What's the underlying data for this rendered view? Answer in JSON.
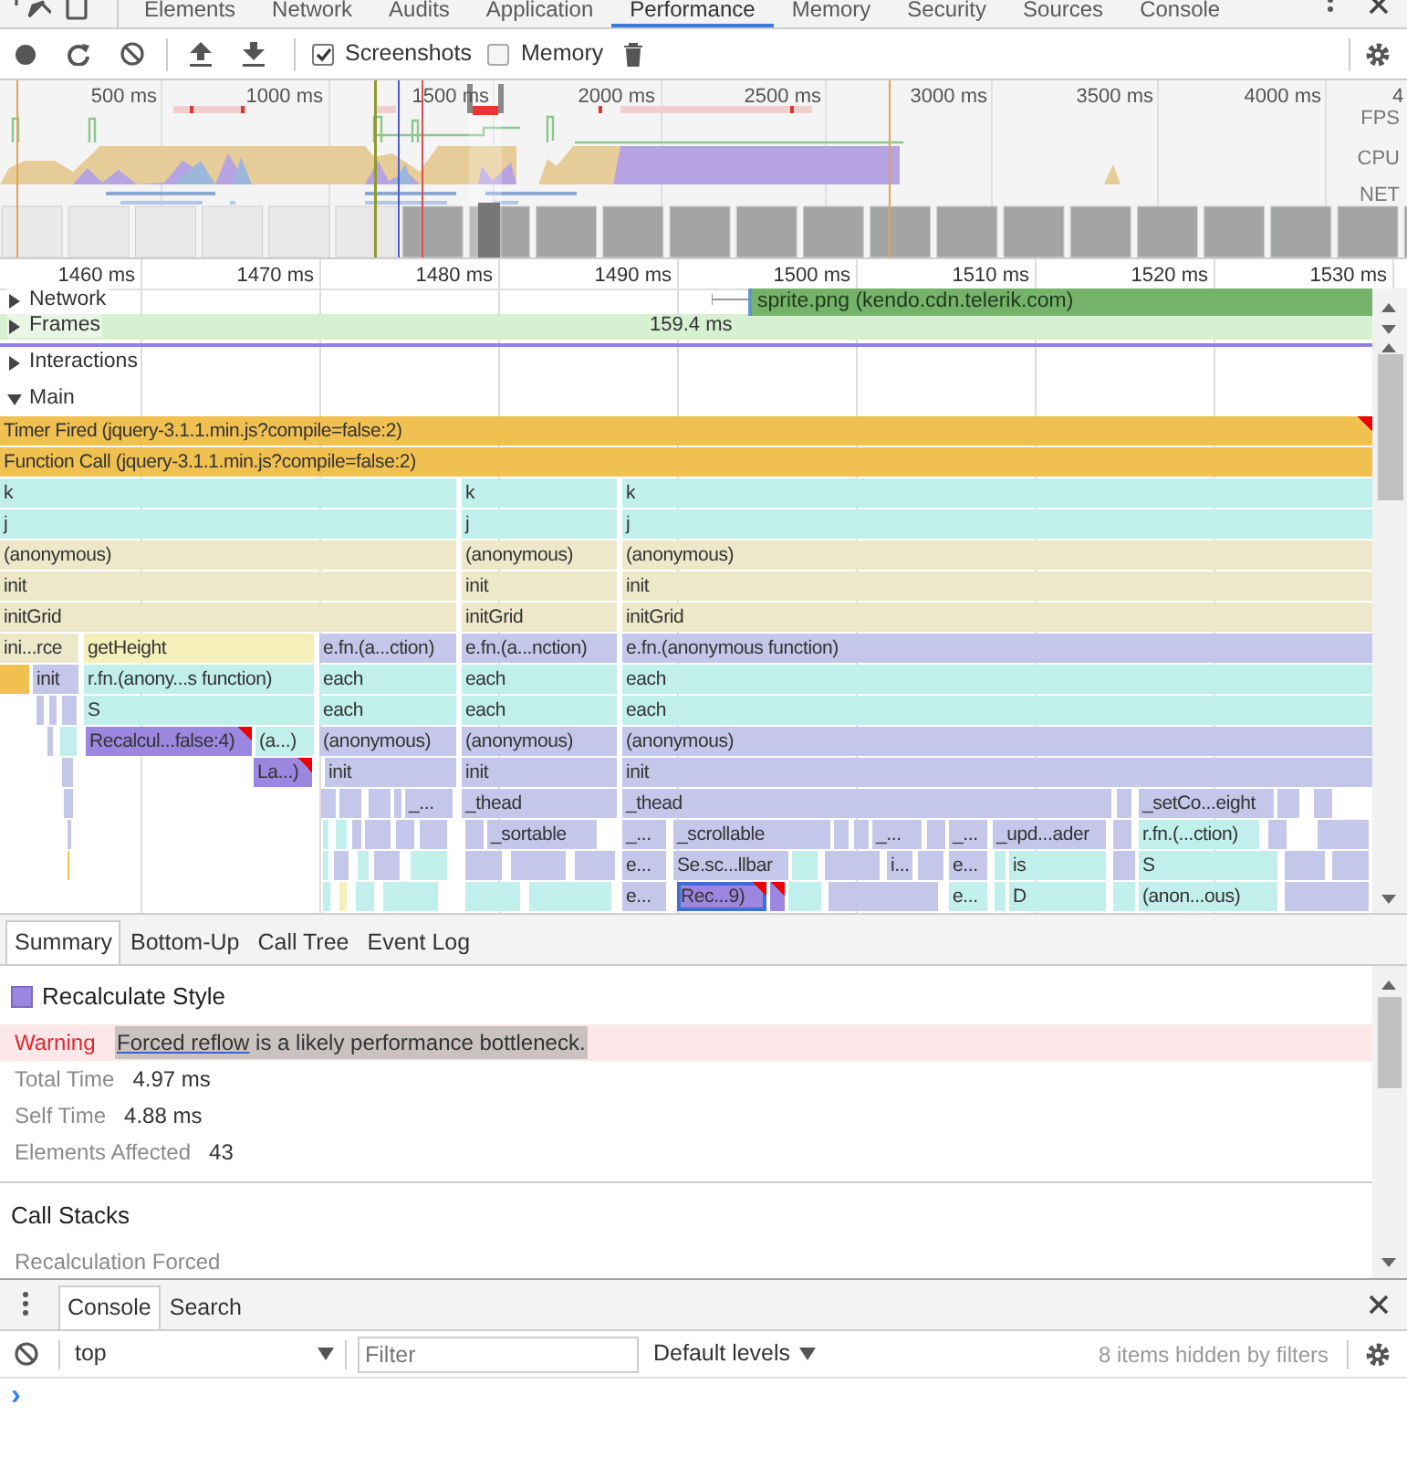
{
  "top_tabs": [
    {
      "label": "Elements",
      "selected": false
    },
    {
      "label": "Network",
      "selected": false
    },
    {
      "label": "Audits",
      "selected": false
    },
    {
      "label": "Application",
      "selected": false
    },
    {
      "label": "Performance",
      "selected": true
    },
    {
      "label": "Memory",
      "selected": false
    },
    {
      "label": "Security",
      "selected": false
    },
    {
      "label": "Sources",
      "selected": false
    },
    {
      "label": "Console",
      "selected": false
    }
  ],
  "toolbar": {
    "options": [
      {
        "label": "Screenshots",
        "checked": true
      },
      {
        "label": "Memory",
        "checked": false
      }
    ]
  },
  "overview": {
    "ticks": [
      "500 ms",
      "1000 ms",
      "1500 ms",
      "2000 ms",
      "2500 ms",
      "3000 ms",
      "3500 ms",
      "4000 ms",
      "4"
    ],
    "lanes": [
      "FPS",
      "CPU",
      "NET"
    ]
  },
  "ruler": [
    "1460 ms",
    "1470 ms",
    "1480 ms",
    "1490 ms",
    "1500 ms",
    "1510 ms",
    "1520 ms",
    "1530 ms"
  ],
  "tracks": [
    {
      "label": "Network",
      "expanded": false
    },
    {
      "label": "Frames",
      "expanded": false
    },
    {
      "label": "Interactions",
      "expanded": false
    },
    {
      "label": "Main",
      "expanded": true
    }
  ],
  "network_request": "sprite.png (kendo.cdn.telerik.com)",
  "frame_duration": "159.4 ms",
  "flame_rows": [
    [
      {
        "label": "Timer Fired (jquery-3.1.1.min.js?compile=false:2)",
        "color": "#f0c050",
        "warning": true,
        "selected": false
      }
    ],
    [
      {
        "label": "Function Call (jquery-3.1.1.min.js?compile=false:2)",
        "color": "#f0c050",
        "warning": false,
        "selected": false
      }
    ],
    [
      {
        "label": "k",
        "color": "#c1efec",
        "warning": false,
        "selected": false
      },
      {
        "label": "k",
        "color": "#c1efec",
        "warning": false,
        "selected": false
      },
      {
        "label": "k",
        "color": "#c1efec",
        "warning": false,
        "selected": false
      }
    ],
    [
      {
        "label": "j",
        "color": "#c1efec",
        "warning": false,
        "selected": false
      },
      {
        "label": "j",
        "color": "#c1efec",
        "warning": false,
        "selected": false
      },
      {
        "label": "j",
        "color": "#c1efec",
        "warning": false,
        "selected": false
      }
    ],
    [
      {
        "label": "(anonymous)",
        "color": "#ece8c9",
        "warning": false,
        "selected": false
      },
      {
        "label": "(anonymous)",
        "color": "#ece8c9",
        "warning": false,
        "selected": false
      },
      {
        "label": "(anonymous)",
        "color": "#ece8c9",
        "warning": false,
        "selected": false
      }
    ],
    [
      {
        "label": "init",
        "color": "#ece8c9",
        "warning": false,
        "selected": false
      },
      {
        "label": "init",
        "color": "#ece8c9",
        "warning": false,
        "selected": false
      },
      {
        "label": "init",
        "color": "#ece8c9",
        "warning": false,
        "selected": false
      }
    ],
    [
      {
        "label": "initGrid",
        "color": "#ece8c9",
        "warning": false,
        "selected": false
      },
      {
        "label": "initGrid",
        "color": "#ece8c9",
        "warning": false,
        "selected": false
      },
      {
        "label": "initGrid",
        "color": "#ece8c9",
        "warning": false,
        "selected": false
      }
    ],
    [
      {
        "label": "ini...rce",
        "color": "#ece8c9",
        "warning": false,
        "selected": false
      },
      {
        "label": "getHeight",
        "color": "#f5efb9",
        "warning": false,
        "selected": false
      },
      {
        "label": "e.fn.(a...ction)",
        "color": "#c5c7ea",
        "warning": false,
        "selected": false
      },
      {
        "label": "e.fn.(a...nction)",
        "color": "#c5c7ea",
        "warning": false,
        "selected": false
      },
      {
        "label": "e.fn.(anonymous function)",
        "color": "#c5c7ea",
        "warning": false,
        "selected": false
      }
    ],
    [
      {
        "color": "#f0c050",
        "warning": false,
        "selected": false
      },
      {
        "label": "init",
        "color": "#c5c7ea",
        "warning": false,
        "selected": false
      },
      {
        "label": "r.fn.(anony...s function)",
        "color": "#c1efec",
        "warning": false,
        "selected": false
      },
      {
        "label": "each",
        "color": "#c1efec",
        "warning": false,
        "selected": false
      },
      {
        "label": "each",
        "color": "#c1efec",
        "warning": false,
        "selected": false
      },
      {
        "label": "each",
        "color": "#c1efec",
        "warning": false,
        "selected": false
      }
    ],
    [
      {
        "label": "S",
        "color": "#c1efec",
        "warning": false,
        "selected": false
      },
      {
        "label": "each",
        "color": "#c1efec",
        "warning": false,
        "selected": false
      },
      {
        "label": "each",
        "color": "#c1efec",
        "warning": false,
        "selected": false
      },
      {
        "label": "each",
        "color": "#c1efec",
        "warning": false,
        "selected": false
      }
    ],
    [
      {
        "label": "Recalcul...false:4)",
        "color": "#9b86e0",
        "warning": true,
        "selected": false
      },
      {
        "label": "(a...)",
        "color": "#c1efec",
        "warning": false,
        "selected": false
      },
      {
        "label": "(anonymous)",
        "color": "#c5c7ea",
        "warning": false,
        "selected": false
      },
      {
        "label": "(anonymous)",
        "color": "#c5c7ea",
        "warning": false,
        "selected": false
      },
      {
        "label": "(anonymous)",
        "color": "#c5c7ea",
        "warning": false,
        "selected": false
      }
    ],
    [
      {
        "label": "La...)",
        "color": "#9b86e0",
        "warning": true,
        "selected": false
      },
      {
        "label": "init",
        "color": "#c5c7ea",
        "warning": false,
        "selected": false
      },
      {
        "label": "init",
        "color": "#c5c7ea",
        "warning": false,
        "selected": false
      },
      {
        "label": "init",
        "color": "#c5c7ea",
        "warning": false,
        "selected": false
      }
    ],
    [
      {
        "label": "_...",
        "color": "#c5c7ea",
        "warning": false,
        "selected": false
      },
      {
        "label": "_thead",
        "color": "#c5c7ea",
        "warning": false,
        "selected": false
      },
      {
        "label": "_thead",
        "color": "#c5c7ea",
        "warning": false,
        "selected": false
      },
      {
        "label": "_setCo...eight",
        "color": "#c5c7ea",
        "warning": false,
        "selected": false
      }
    ],
    [
      {
        "label": "_sortable",
        "color": "#c5c7ea",
        "warning": false,
        "selected": false
      },
      {
        "label": "_...",
        "color": "#c5c7ea",
        "warning": false,
        "selected": false
      },
      {
        "label": "_scrollable",
        "color": "#c5c7ea",
        "warning": false,
        "selected": false
      },
      {
        "label": "_...",
        "color": "#c5c7ea",
        "warning": false,
        "selected": false
      },
      {
        "label": "_...",
        "color": "#c5c7ea",
        "warning": false,
        "selected": false
      },
      {
        "label": "_upd...ader",
        "color": "#c5c7ea",
        "warning": false,
        "selected": false
      },
      {
        "label": "r.fn.(...ction)",
        "color": "#c1efec",
        "warning": false,
        "selected": false
      }
    ],
    [
      {
        "label": "e...",
        "color": "#c5c7ea",
        "warning": false,
        "selected": false
      },
      {
        "label": "Se.sc...llbar",
        "color": "#c5c7ea",
        "warning": false,
        "selected": false
      },
      {
        "label": "i...",
        "color": "#c5c7ea",
        "warning": false,
        "selected": false
      },
      {
        "label": "e...",
        "color": "#c5c7ea",
        "warning": false,
        "selected": false
      },
      {
        "label": "is",
        "color": "#c1efec",
        "warning": false,
        "selected": false
      },
      {
        "label": "S",
        "color": "#c1efec",
        "warning": false,
        "selected": false
      }
    ],
    [
      {
        "label": "e...",
        "color": "#c5c7ea",
        "warning": false,
        "selected": false
      },
      {
        "label": "Rec...9)",
        "color": "#9b86e0",
        "warning": true,
        "selected": true
      },
      {
        "color": "#9b86e0",
        "warning": true,
        "selected": false
      },
      {
        "label": "e...",
        "color": "#c1efec",
        "warning": false,
        "selected": false
      },
      {
        "label": "D",
        "color": "#c1efec",
        "warning": false,
        "selected": false
      },
      {
        "label": "(anon...ous)",
        "color": "#c1efec",
        "warning": false,
        "selected": false
      }
    ]
  ],
  "details": {
    "tabs": [
      {
        "label": "Summary",
        "selected": true
      },
      {
        "label": "Bottom-Up",
        "selected": false
      },
      {
        "label": "Call Tree",
        "selected": false
      },
      {
        "label": "Event Log",
        "selected": false
      }
    ],
    "event": {
      "title": "Recalculate Style",
      "color": "#9b86e0"
    },
    "warning": {
      "label": "Warning",
      "link": "Forced reflow",
      "message": " is a likely performance bottleneck."
    },
    "stats": [
      {
        "label": "Total Time",
        "value": "4.97 ms"
      },
      {
        "label": "Self Time",
        "value": "4.88 ms"
      },
      {
        "label": "Elements Affected",
        "value": "43"
      }
    ],
    "section": "Call Stacks",
    "subsection": "Recalculation Forced"
  },
  "drawer": {
    "tabs": [
      {
        "label": "Console",
        "selected": true
      },
      {
        "label": "Search",
        "selected": false
      }
    ],
    "context": "top",
    "filter_placeholder": "Filter",
    "levels": "Default levels",
    "hidden_note": "8 items hidden by filters",
    "prompt": "›"
  }
}
